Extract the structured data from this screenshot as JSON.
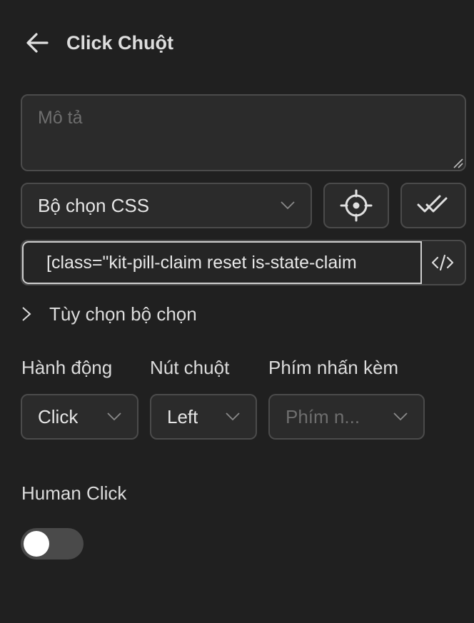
{
  "header": {
    "title": "Click Chuột"
  },
  "description": {
    "placeholder": "Mô tả",
    "value": ""
  },
  "selector_type": {
    "value": "Bộ chọn CSS"
  },
  "selector": {
    "value": "[class=\"kit-pill-claim reset is-state-claim"
  },
  "selector_options": {
    "label": "Tùy chọn bộ chọn"
  },
  "action": {
    "label": "Hành động",
    "value": "Click"
  },
  "mouse_button": {
    "label": "Nút chuột",
    "value": "Left"
  },
  "modifier_keys": {
    "label": "Phím nhấn kèm",
    "placeholder": "Phím n..."
  },
  "human_click": {
    "label": "Human Click",
    "enabled": false
  },
  "colors": {
    "background": "#202020",
    "field_bg": "#2b2b2b",
    "border": "#4b4b4b",
    "focus_border": "#cfcfcf",
    "text": "#e6e6e6",
    "placeholder": "#6e6e6e"
  },
  "icons": {
    "back": "arrow-left-icon",
    "chevron": "chevron-down-icon",
    "target": "crosshair-icon",
    "verify": "double-check-icon",
    "code": "code-icon",
    "expand": "chevron-right-icon"
  }
}
